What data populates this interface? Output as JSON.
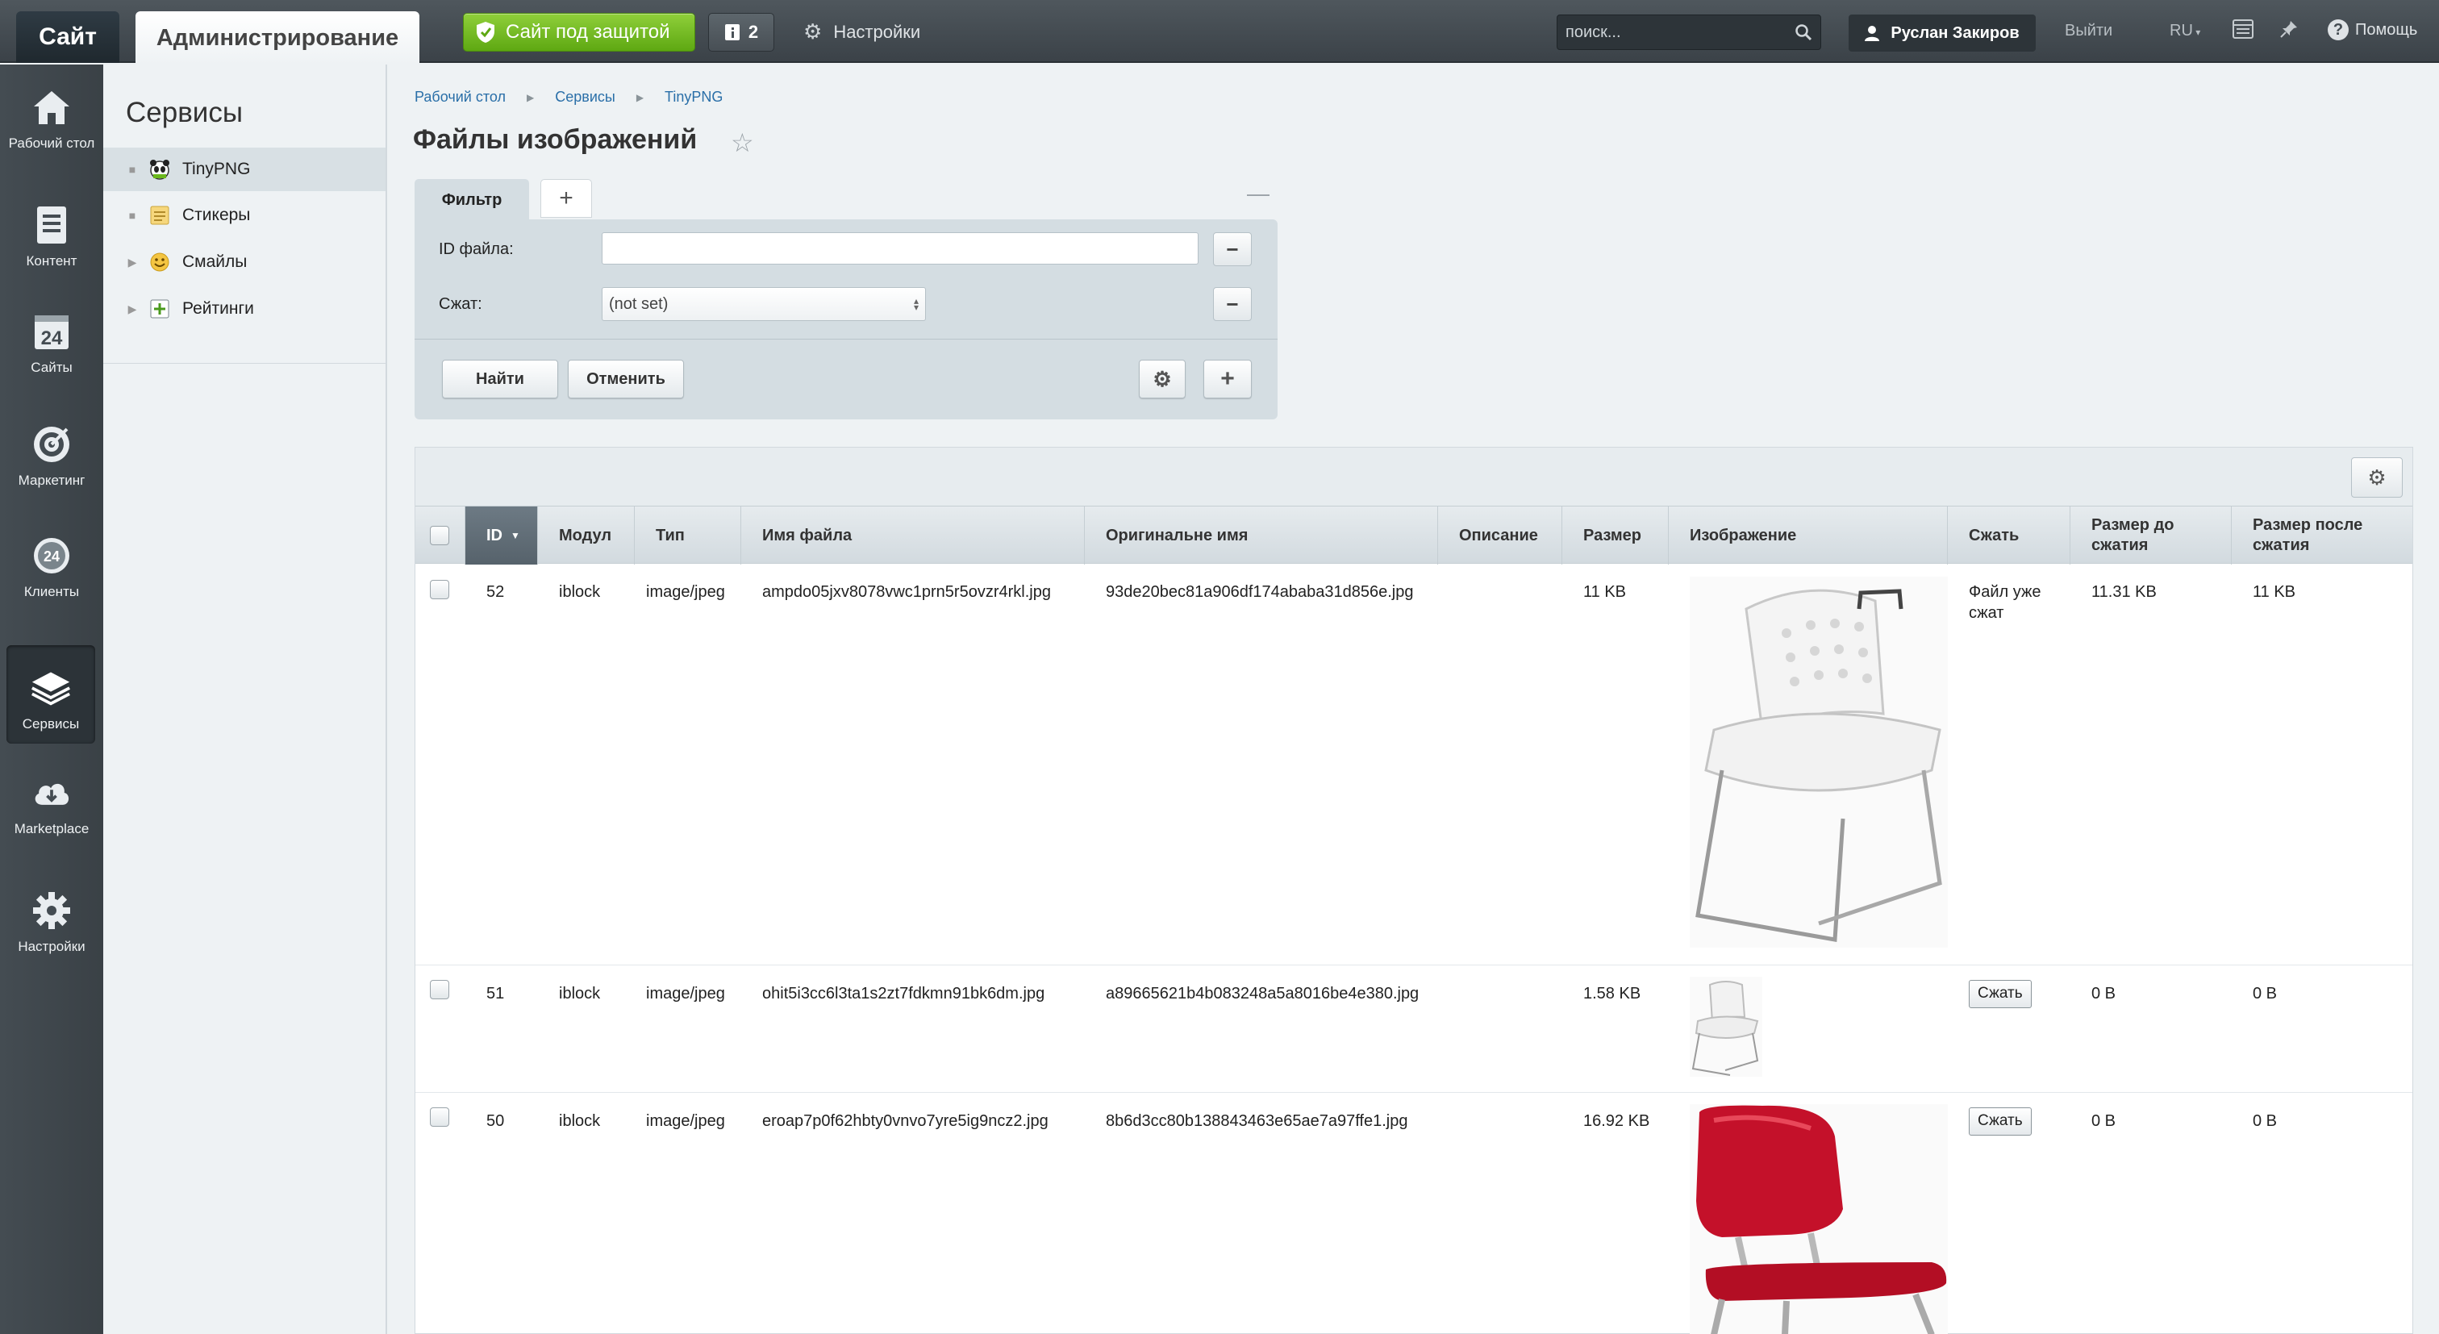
{
  "topbar": {
    "site_tab": "Сайт",
    "admin_tab": "Администрирование",
    "protect_button": "Сайт под защитой",
    "notifications_count": "2",
    "settings_label": "Настройки",
    "search_placeholder": "поиск...",
    "user_name": "Руслан Закиров",
    "logout": "Выйти",
    "language": "RU",
    "help": "Помощь"
  },
  "leftmenu": [
    {
      "label": "Рабочий стол",
      "icon": "home-icon"
    },
    {
      "label": "Контент",
      "icon": "document-icon"
    },
    {
      "label": "Сайты",
      "icon": "calendar-icon"
    },
    {
      "label": "Маркетинг",
      "icon": "target-icon"
    },
    {
      "label": "Клиенты",
      "icon": "clients-icon"
    },
    {
      "label": "Сервисы",
      "icon": "layers-icon"
    },
    {
      "label": "Marketplace",
      "icon": "cloud-download-icon"
    },
    {
      "label": "Настройки",
      "icon": "gear-icon"
    }
  ],
  "submenu": {
    "title": "Сервисы",
    "items": [
      {
        "label": "TinyPNG",
        "icon": "panda-icon"
      },
      {
        "label": "Стикеры",
        "icon": "sticker-icon"
      },
      {
        "label": "Смайлы",
        "icon": "smiley-icon"
      },
      {
        "label": "Рейтинги",
        "icon": "rating-icon"
      }
    ]
  },
  "breadcrumb": [
    "Рабочий стол",
    "Сервисы",
    "TinyPNG"
  ],
  "page_title": "Файлы изображений",
  "filter": {
    "tab_label": "Фильтр",
    "file_id_label": "ID файла:",
    "file_id_value": "",
    "compressed_label": "Сжат:",
    "compressed_value": "(not set)",
    "find_button": "Найти",
    "cancel_button": "Отменить"
  },
  "grid": {
    "columns": [
      "ID",
      "Модул",
      "Тип",
      "Имя файла",
      "Оригинальне имя",
      "Описание",
      "Размер",
      "Изображение",
      "Сжать",
      "Размер до сжатия",
      "Размер после сжатия"
    ],
    "rows": [
      {
        "id": "52",
        "module": "iblock",
        "type": "image/jpeg",
        "file_name": "ampdo05jxv8078vwc1prn5r5ovzr4rkl.jpg",
        "original_name": "93de20bec81a906df174ababa31d856e.jpg",
        "description": "",
        "size": "11 KB",
        "image": "white-chair",
        "compress": "Файл уже сжат",
        "size_before": "11.31 KB",
        "size_after": "11 KB"
      },
      {
        "id": "51",
        "module": "iblock",
        "type": "image/jpeg",
        "file_name": "ohit5i3cc6l3ta1s2zt7fdkmn91bk6dm.jpg",
        "original_name": "a89665621b4b083248a5a8016be4e380.jpg",
        "description": "",
        "size": "1.58 KB",
        "image": "white-chair-small",
        "compress": "Сжать",
        "size_before": "0 B",
        "size_after": "0 B"
      },
      {
        "id": "50",
        "module": "iblock",
        "type": "image/jpeg",
        "file_name": "eroap7p0f62hbty0vnvo7yre5ig9ncz2.jpg",
        "original_name": "8b6d3cc80b138843463e65ae7a97ffe1.jpg",
        "description": "",
        "size": "16.92 KB",
        "image": "red-chair",
        "compress": "Сжать",
        "size_before": "0 B",
        "size_after": "0 B"
      }
    ]
  },
  "colors": {
    "topbar": "#444c52",
    "accent_green": "#6bb81c",
    "link": "#2a6fa8",
    "sorted_header": "#5f6b74"
  }
}
